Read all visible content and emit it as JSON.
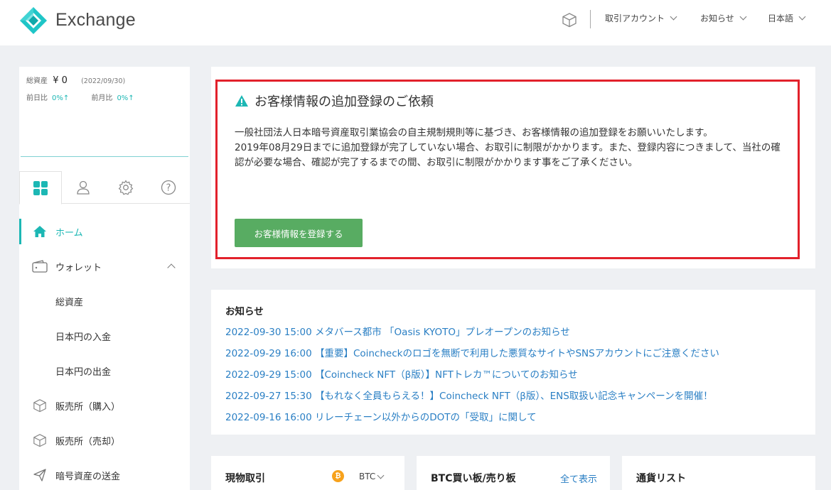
{
  "header": {
    "brand": "Exchange",
    "menu": [
      {
        "label": "取引アカウント"
      },
      {
        "label": "お知らせ"
      },
      {
        "label": "日本語"
      }
    ],
    "box_icon": "cube-icon"
  },
  "sidebar": {
    "total_assets_label": "総資産",
    "total_assets_value": "¥ 0",
    "total_assets_date": "(2022/09/30)",
    "prev_day_label": "前日比",
    "prev_day_value": "0%↑",
    "prev_month_label": "前月比",
    "prev_month_value": "0%↑",
    "tabs": [
      "dashboard-icon",
      "user-icon",
      "gear-icon",
      "help-icon"
    ],
    "nav": [
      {
        "label": "ホーム",
        "icon": "home-icon",
        "active": true
      },
      {
        "label": "ウォレット",
        "icon": "wallet-icon"
      },
      {
        "label": "総資産"
      },
      {
        "label": "日本円の入金"
      },
      {
        "label": "日本円の出金"
      },
      {
        "label": "販売所（購入）",
        "icon": "cube-icon"
      },
      {
        "label": "販売所（売却）",
        "icon": "cube-icon"
      },
      {
        "label": "暗号資産の送金",
        "icon": "send-icon"
      }
    ]
  },
  "notice": {
    "title": "お客様情報の追加登録のご依頼",
    "line1": "一般社団法人日本暗号資産取引業協会の自主規制規則等に基づき、お客様情報の追加登録をお願いいたします。",
    "line2": "2019年08月29日までに追加登録が完了していない場合、お取引に制限がかかります。また、登録内容につきまして、当社の確認が必要な場合、確認が完了するまでの間、お取引に制限がかかります事をご了承ください。",
    "button": "お客様情報を登録する"
  },
  "news": {
    "title": "お知らせ",
    "items": [
      "2022-09-30 15:00 メタバース都市 「Oasis KYOTO」プレオープンのお知らせ",
      "2022-09-29 16:00 【重要】Coincheckのロゴを無断で利用した悪質なサイトやSNSアカウントにご注意ください",
      "2022-09-29 15:00 【Coincheck NFT（β版）】NFTトレカ™についてのお知らせ",
      "2022-09-27 15:30 【もれなく全員もらえる！】Coincheck NFT（β版）、ENS取扱い記念キャンペーンを開催！",
      "2022-09-16 16:00 リレーチェーン以外からのDOTの「受取」に関して"
    ]
  },
  "cards": {
    "spot_title": "現物取引",
    "spot_currency": "BTC",
    "orderbook_title": "BTC買い板/売り板",
    "orderbook_showall": "全て表示",
    "currency_list_title": "通貨リスト"
  },
  "colors": {
    "accent": "#1cb7b4",
    "link": "#2a7fc4",
    "alert_border": "#e2212b",
    "button": "#58ac62"
  }
}
